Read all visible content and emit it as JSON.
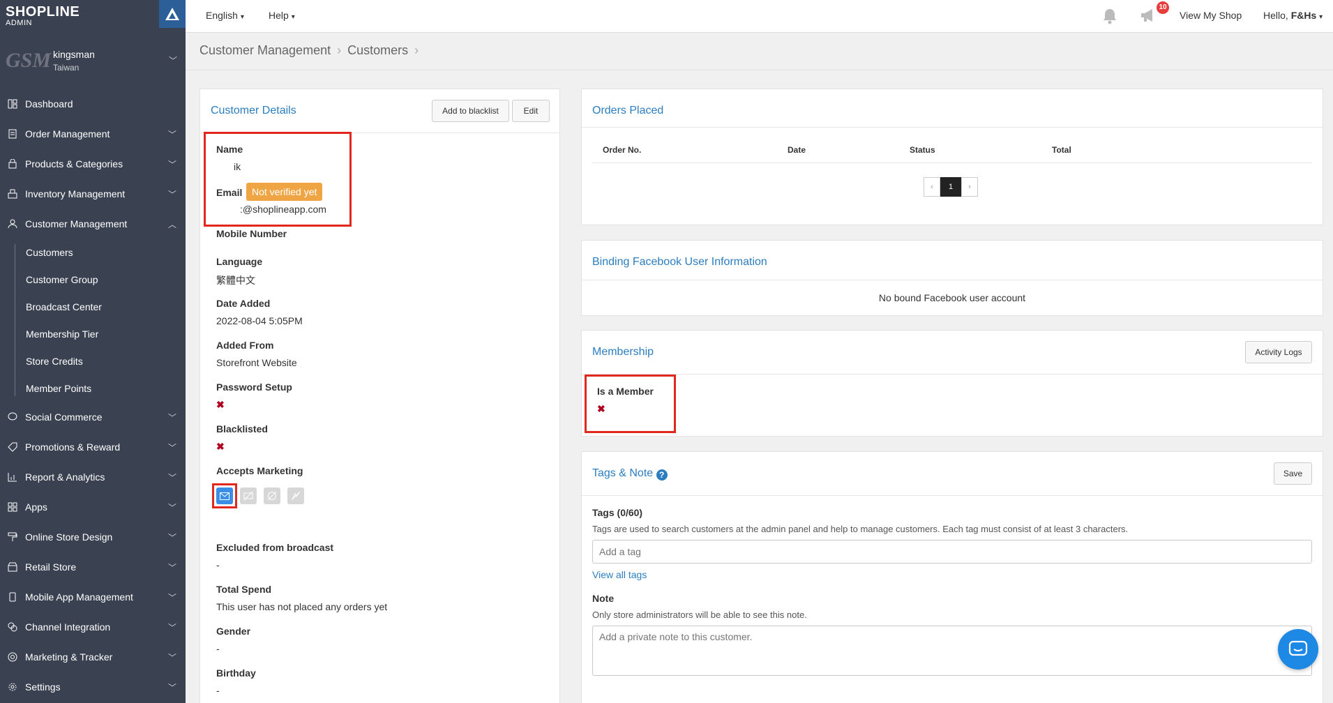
{
  "sidebar": {
    "brand": "SHOPLINE",
    "brand_sub": "ADMIN",
    "store_logo_text": "GSM",
    "store_name": "kingsman",
    "store_region": "Taiwan",
    "items": [
      {
        "label": "Dashboard",
        "icon": "dashboard-icon"
      },
      {
        "label": "Order Management",
        "icon": "order-icon"
      },
      {
        "label": "Products & Categories",
        "icon": "bag-icon"
      },
      {
        "label": "Inventory Management",
        "icon": "inventory-icon"
      },
      {
        "label": "Customer Management",
        "icon": "user-icon"
      },
      {
        "label": "Social Commerce",
        "icon": "chat-bubble-icon"
      },
      {
        "label": "Promotions & Reward",
        "icon": "tag-icon"
      },
      {
        "label": "Report & Analytics",
        "icon": "chart-icon"
      },
      {
        "label": "Apps",
        "icon": "apps-icon"
      },
      {
        "label": "Online Store Design",
        "icon": "paint-roller-icon"
      },
      {
        "label": "Retail Store",
        "icon": "store-icon"
      },
      {
        "label": "Mobile App Management",
        "icon": "mobile-icon"
      },
      {
        "label": "Channel Integration",
        "icon": "integration-icon"
      },
      {
        "label": "Marketing & Tracker",
        "icon": "target-icon"
      },
      {
        "label": "Settings",
        "icon": "gear-icon"
      }
    ],
    "customer_sub": [
      "Customers",
      "Customer Group",
      "Broadcast Center",
      "Membership Tier",
      "Store Credits",
      "Member Points"
    ]
  },
  "topbar": {
    "language": "English",
    "help": "Help",
    "notif_count": "10",
    "view_shop": "View My Shop",
    "hello_prefix": "Hello,",
    "user": "F&Hs"
  },
  "breadcrumb": {
    "root": "Customer Management",
    "current": "Customers"
  },
  "customer_details": {
    "title": "Customer Details",
    "blacklist_button": "Add to blacklist",
    "edit_button": "Edit",
    "name_label": "Name",
    "name_value": "ik",
    "email_label": "Email",
    "email_status": "Not verified yet",
    "email_value": ":@shoplineapp.com",
    "mobile_label": "Mobile Number",
    "language_label": "Language",
    "language_value": "繁體中文",
    "date_label": "Date Added",
    "date_value": "2022-08-04 5:05PM",
    "added_from_label": "Added From",
    "added_from_value": "Storefront Website",
    "password_label": "Password Setup",
    "blacklisted_label": "Blacklisted",
    "marketing_label": "Accepts Marketing",
    "excluded_label": "Excluded from broadcast",
    "excluded_value": "-",
    "spend_label": "Total Spend",
    "spend_value": "This user has not placed any orders yet",
    "gender_label": "Gender",
    "gender_value": "-",
    "birthday_label": "Birthday",
    "birthday_value": "-"
  },
  "orders": {
    "title": "Orders Placed",
    "columns": [
      "Order No.",
      "Date",
      "Status",
      "Total"
    ],
    "prev": "‹",
    "page": "1",
    "next": "›"
  },
  "facebook": {
    "title": "Binding Facebook User Information",
    "empty": "No bound Facebook user account"
  },
  "membership": {
    "title": "Membership",
    "logs_button": "Activity Logs",
    "member_label": "Is a Member"
  },
  "tags_note": {
    "title": "Tags & Note",
    "save_button": "Save",
    "tags_label": "Tags (0/60)",
    "tags_help": "Tags are used to search customers at the admin panel and help to manage customers. Each tag must consist of at least 3 characters.",
    "tags_placeholder": "Add a tag",
    "view_all": "View all tags",
    "note_label": "Note",
    "note_help": "Only store administrators will be able to see this note.",
    "note_placeholder": "Add a private note to this customer."
  },
  "colors": {
    "accent": "#2b7dbf",
    "sidebar": "#3a4150",
    "warn": "#f0a545",
    "highlight": "#e0281e"
  }
}
